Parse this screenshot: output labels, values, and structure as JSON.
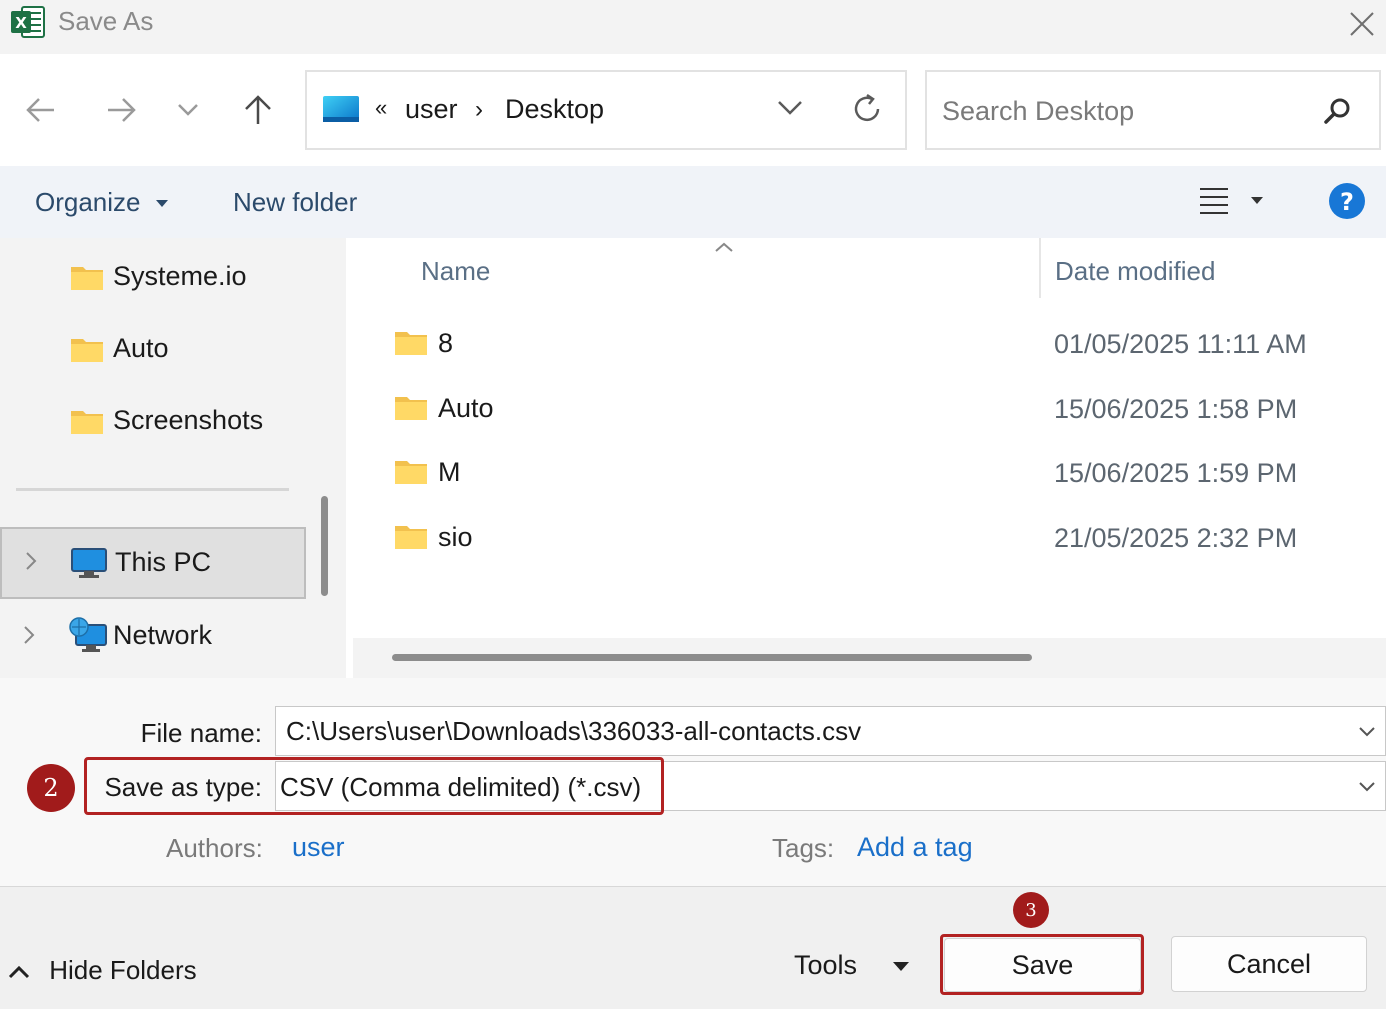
{
  "window": {
    "title": "Save As",
    "app_icon": "excel-icon"
  },
  "nav": {
    "back_icon": "arrow-left-icon",
    "forward_icon": "arrow-right-icon",
    "recent_icon": "chevron-down-icon",
    "up_icon": "arrow-up-icon"
  },
  "address": {
    "overflow": "«",
    "crumbs": [
      "user",
      "Desktop"
    ],
    "separator": "›",
    "refresh_icon": "refresh-icon"
  },
  "search": {
    "placeholder": "Search Desktop",
    "icon": "search-icon"
  },
  "toolbar": {
    "organize": "Organize",
    "new_folder": "New folder",
    "view_icon": "view-list-icon",
    "help_icon": "help-icon"
  },
  "sidebar": {
    "items": [
      {
        "label": "Systeme.io",
        "icon": "folder-icon"
      },
      {
        "label": "Auto",
        "icon": "folder-icon"
      },
      {
        "label": "Screenshots",
        "icon": "folder-icon"
      },
      {
        "label": "This PC",
        "icon": "computer-icon",
        "selected": true
      },
      {
        "label": "Network",
        "icon": "network-icon"
      }
    ]
  },
  "filelist": {
    "columns": [
      "Name",
      "Date modified"
    ],
    "sort_icon": "sort-up-icon",
    "rows": [
      {
        "name": "8",
        "date": "01/05/2025 11:11 AM"
      },
      {
        "name": "Auto",
        "date": "15/06/2025 1:58 PM"
      },
      {
        "name": "M",
        "date": "15/06/2025 1:59 PM"
      },
      {
        "name": "sio",
        "date": "21/05/2025 2:32 PM"
      }
    ]
  },
  "form": {
    "file_name_label": "File name:",
    "file_name_value": "C:\\Users\\user\\Downloads\\336033-all-contacts.csv",
    "save_type_label": "Save as type:",
    "save_type_value": "CSV (Comma delimited) (*.csv)",
    "authors_label": "Authors:",
    "authors_value": "user",
    "tags_label": "Tags:",
    "tags_value": "Add a tag"
  },
  "annotations": {
    "step2": "2",
    "step3": "3",
    "highlight_color": "#b22222"
  },
  "footer": {
    "hide_folders": "Hide Folders",
    "tools": "Tools",
    "save": "Save",
    "cancel": "Cancel"
  }
}
